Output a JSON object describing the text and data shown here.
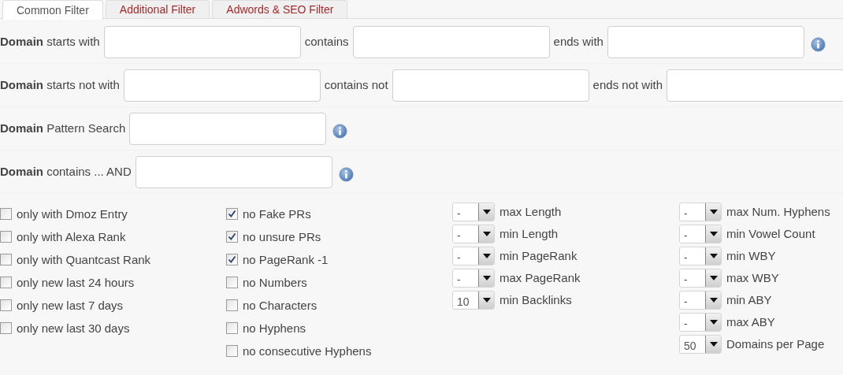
{
  "tabs": [
    {
      "label": "Common Filter",
      "selected": true
    },
    {
      "label": "Additional Filter",
      "selected": false
    },
    {
      "label": "Adwords & SEO Filter",
      "selected": false
    }
  ],
  "filter_rows": [
    {
      "parts": [
        {
          "kind": "label",
          "text": "**Domain** starts with"
        },
        {
          "kind": "field"
        },
        {
          "kind": "label",
          "text": "contains"
        },
        {
          "kind": "field"
        },
        {
          "kind": "label",
          "text": "ends with"
        },
        {
          "kind": "field"
        },
        {
          "kind": "info"
        }
      ]
    },
    {
      "parts": [
        {
          "kind": "label",
          "text": "**Domain** starts not with"
        },
        {
          "kind": "field"
        },
        {
          "kind": "label",
          "text": "contains not"
        },
        {
          "kind": "field"
        },
        {
          "kind": "label",
          "text": "ends not with"
        },
        {
          "kind": "field"
        }
      ]
    },
    {
      "parts": [
        {
          "kind": "label",
          "text": "**Domain** Pattern Search"
        },
        {
          "kind": "field"
        },
        {
          "kind": "info"
        }
      ]
    },
    {
      "parts": [
        {
          "kind": "label",
          "text": "**Domain** contains ... AND"
        },
        {
          "kind": "field"
        },
        {
          "kind": "info"
        }
      ]
    }
  ],
  "checkbox_columns": [
    [
      {
        "label": "only with Dmoz Entry",
        "checked": false
      },
      {
        "label": "only with Alexa Rank",
        "checked": false
      },
      {
        "label": "only with Quantcast Rank",
        "checked": false
      },
      {
        "label": "only new last 24 hours",
        "checked": false
      },
      {
        "label": "only new last 7 days",
        "checked": false
      },
      {
        "label": "only new last 30 days",
        "checked": false
      }
    ],
    [
      {
        "label": "no Fake PRs",
        "checked": true
      },
      {
        "label": "no unsure PRs",
        "checked": true
      },
      {
        "label": "no PageRank -1",
        "checked": true
      },
      {
        "label": "no Numbers",
        "checked": false
      },
      {
        "label": "no Characters",
        "checked": false
      },
      {
        "label": "no Hyphens",
        "checked": false
      },
      {
        "label": "no consecutive Hyphens",
        "checked": false
      }
    ]
  ],
  "select_columns": [
    [
      {
        "value": "-",
        "label": "max Length"
      },
      {
        "value": "-",
        "label": "min Length"
      },
      {
        "value": "-",
        "label": "min PageRank"
      },
      {
        "value": "-",
        "label": "max PageRank"
      },
      {
        "value": "10",
        "label": "min Backlinks"
      }
    ],
    [
      {
        "value": "-",
        "label": "max Num. Hyphens"
      },
      {
        "value": "-",
        "label": "min Vowel Count"
      },
      {
        "value": "-",
        "label": "min WBY"
      },
      {
        "value": "-",
        "label": "max WBY"
      },
      {
        "value": "-",
        "label": "min ABY"
      },
      {
        "value": "-",
        "label": "max ABY"
      },
      {
        "value": "50",
        "label": "Domains per Page"
      }
    ]
  ]
}
